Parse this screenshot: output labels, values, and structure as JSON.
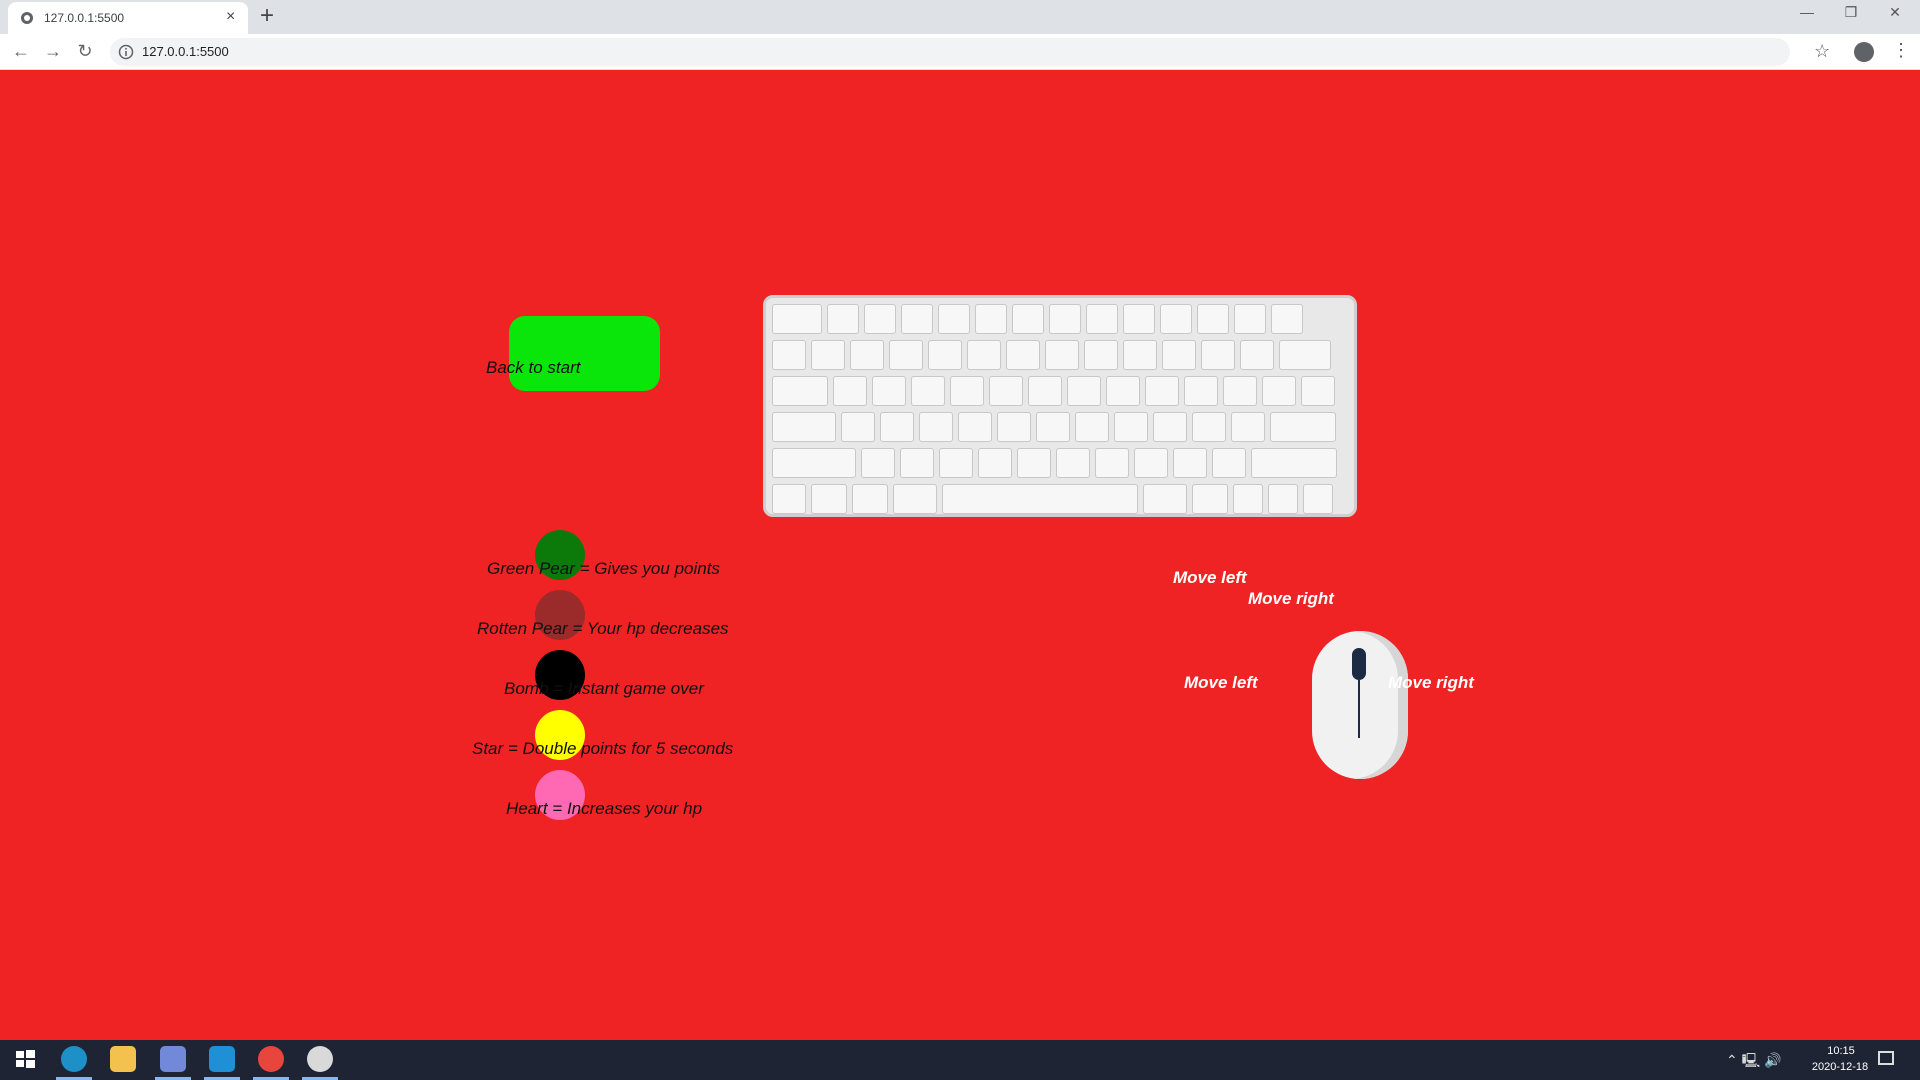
{
  "browser": {
    "tab_title": "127.0.0.1:5500",
    "tab_close": "×",
    "new_tab": "+",
    "url": "127.0.0.1:5500",
    "nav": {
      "back": "←",
      "forward": "→",
      "reload": "↻"
    },
    "window": {
      "minimize": "—",
      "restore": "❐",
      "close": "✕"
    },
    "star": "☆",
    "menu": "⋮"
  },
  "page": {
    "back_button_label": "Back to start",
    "legend": [
      {
        "color": "#0b7a0b",
        "text": "Green Pear = Gives you points"
      },
      {
        "color": "#9b2a2a",
        "text": "Rotten Pear = Your hp decreases"
      },
      {
        "color": "#000000",
        "text": "Bomb = Instant game over"
      },
      {
        "color": "#ffff00",
        "text": "Star = Double points for 5 seconds"
      },
      {
        "color": "#ff69b4",
        "text": "Heart = Increases your hp"
      }
    ],
    "keyboard_labels": {
      "move_left": "Move left",
      "move_right": "Move right"
    },
    "mouse_labels": {
      "move_left": "Move left",
      "move_right": "Move right"
    }
  },
  "taskbar": {
    "time": "10:15",
    "date": "2020-12-18",
    "icons": [
      "windows-start-icon",
      "edge-icon",
      "file-explorer-icon",
      "discord-icon",
      "vscode-icon",
      "chrome-icon",
      "paint-icon"
    ]
  },
  "colors": {
    "background": "#ef2323",
    "button": "#0ae50a"
  }
}
